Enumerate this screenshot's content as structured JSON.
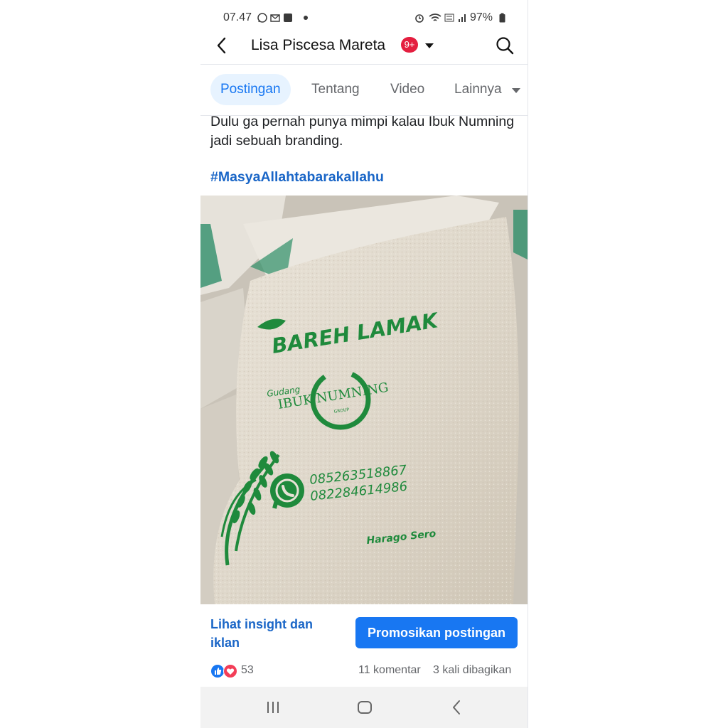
{
  "status_bar": {
    "time": "07.47",
    "battery": "97%"
  },
  "header": {
    "profile_name": "Lisa Piscesa Mareta",
    "notification_badge": "9+"
  },
  "tabs": [
    {
      "label": "Postingan",
      "active": true
    },
    {
      "label": "Tentang",
      "active": false
    },
    {
      "label": "Video",
      "active": false
    },
    {
      "label": "Lainnya",
      "active": false
    }
  ],
  "post": {
    "text": "Dulu ga pernah punya mimpi kalau Ibuk Numning jadi sebuah branding.",
    "hashtag": "#MasyaAllahtabarakallahu",
    "photo": {
      "brand": "BAREH LAMAK",
      "store_prefix": "Gudang",
      "store_name": "IBUK NUMNING",
      "store_suffix": "GROUP",
      "phone_1": "085263518867",
      "phone_2": "082284614986",
      "tagline": "Harago Sero"
    },
    "insight_link": "Lihat insight dan iklan",
    "promote_button": "Promosikan postingan",
    "reaction_count": "53",
    "comment_count": "11 komentar",
    "share_count": "3 kali dibagikan"
  },
  "colors": {
    "accent": "#1877f2",
    "link": "#1a66c7",
    "print_green": "#1f8a3c",
    "badge_red": "#e41e3f"
  },
  "icons": [
    "back-arrow-icon",
    "search-icon",
    "chevron-down-icon",
    "like-icon",
    "love-icon",
    "whatsapp-icon",
    "rice-stalk-icon",
    "recent-apps-icon",
    "home-icon",
    "back-icon"
  ]
}
